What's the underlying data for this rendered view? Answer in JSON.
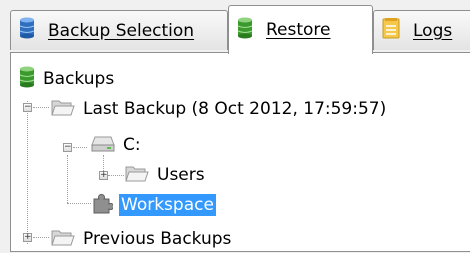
{
  "tabs": [
    {
      "label": "Backup Selection",
      "icon": "database-blue-icon"
    },
    {
      "label": "Restore",
      "icon": "database-green-icon",
      "active": true
    },
    {
      "label": "Logs",
      "icon": "notepad-icon"
    }
  ],
  "tree": {
    "root": {
      "label": "Backups",
      "icon": "database-green-icon"
    },
    "last_backup": {
      "label": "Last Backup (8 Oct 2012, 17:59:57)",
      "icon": "folder-open-icon",
      "expanded": true
    },
    "drive": {
      "label": "C:",
      "icon": "drive-icon",
      "expanded": true
    },
    "users": {
      "label": "Users",
      "icon": "folder-icon",
      "expanded": false
    },
    "workspace": {
      "label": "Workspace",
      "icon": "puzzle-icon",
      "selected": true
    },
    "previous_backups": {
      "label": "Previous Backups",
      "icon": "folder-icon",
      "expanded": false
    }
  },
  "colors": {
    "selection": "#3399ff"
  }
}
